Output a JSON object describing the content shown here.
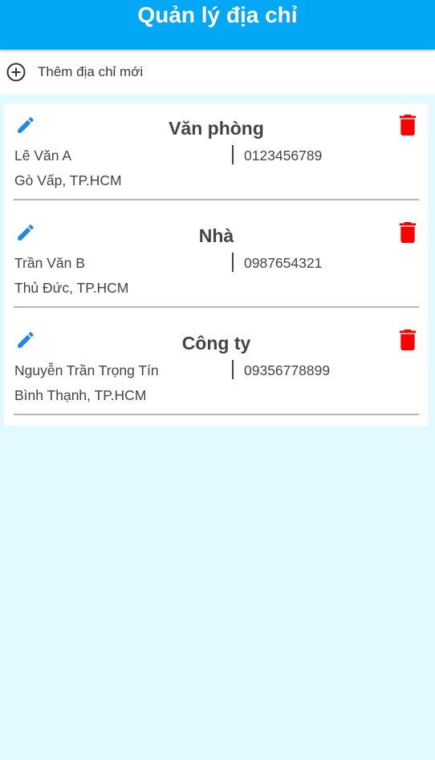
{
  "header": {
    "title": "Quản lý địa chỉ"
  },
  "add_address": {
    "label": "Thêm địa chỉ mới",
    "icon": "plus-circle-icon"
  },
  "addresses": [
    {
      "title": "Văn phòng",
      "name": "Lê Văn A",
      "phone": "0123456789",
      "address": "Gò Vấp, TP.HCM"
    },
    {
      "title": "Nhà",
      "name": "Trần Văn B",
      "phone": "0987654321",
      "address": "Thủ Đức, TP.HCM"
    },
    {
      "title": "Công ty",
      "name": "Nguyễn Trần Trọng Tín",
      "phone": "09356778899",
      "address": "Bình Thạnh, TP.HCM"
    }
  ],
  "icons": {
    "edit": "pencil-icon",
    "delete": "trash-icon"
  },
  "colors": {
    "header_bg": "#03a8f4",
    "page_bg": "#e1f9ff",
    "edit_icon": "#1e88e5",
    "delete_icon": "#ff0000",
    "text": "#444444"
  }
}
